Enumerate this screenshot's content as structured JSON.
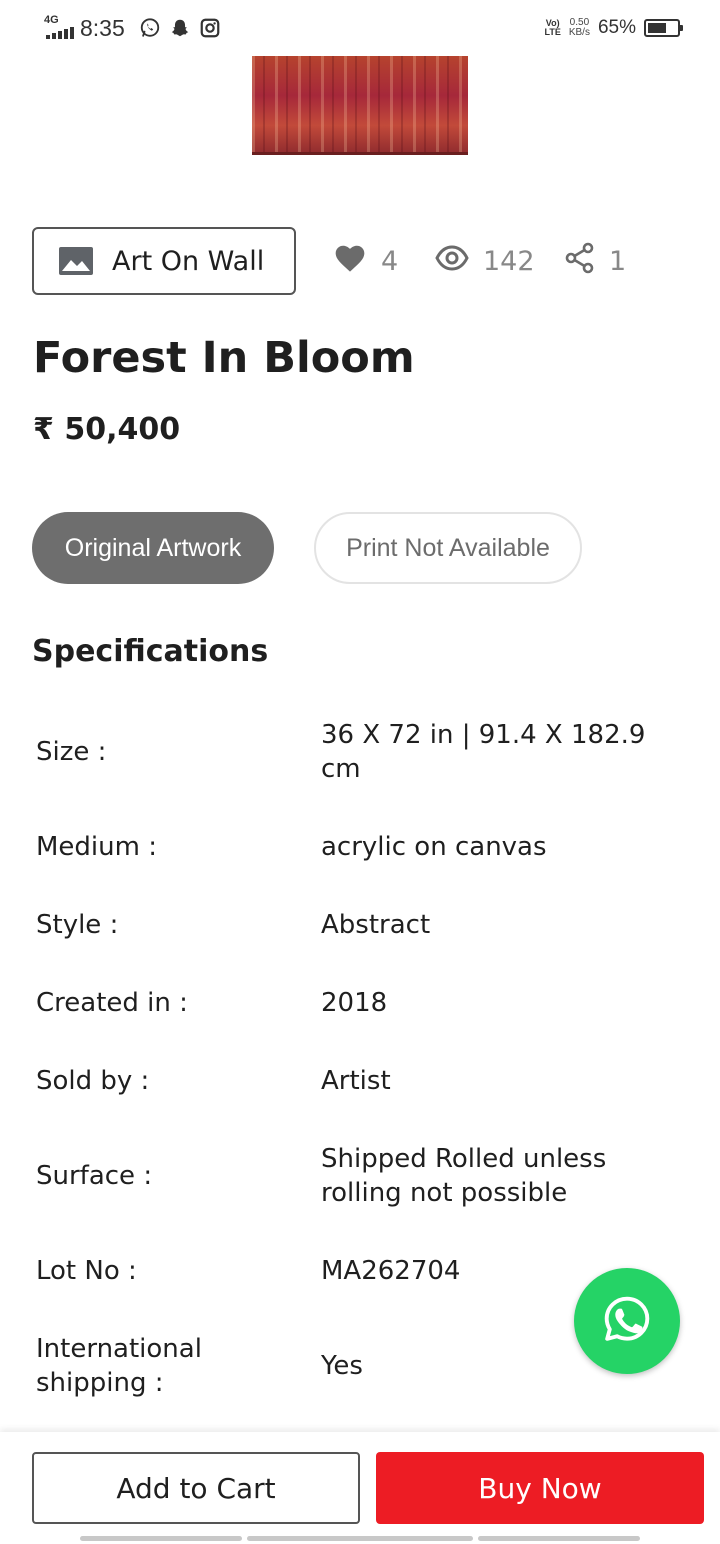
{
  "status_bar": {
    "network": "4G",
    "time": "8:35",
    "apps": [
      "whatsapp-icon",
      "snapchat-icon",
      "instagram-icon"
    ],
    "volte_top": "Vo)",
    "volte_bottom": "LTE",
    "speed_value": "0.50",
    "speed_unit": "KB/s",
    "battery_percent": "65%",
    "battery_level": 0.65
  },
  "artwork": {
    "colors": [
      "#b6432e",
      "#a6283a",
      "#8e2a2e"
    ]
  },
  "info_row": {
    "art_on_wall_label": "Art On Wall",
    "likes": "4",
    "views": "142",
    "shares": "1"
  },
  "product": {
    "title": "Forest In Bloom",
    "price": "₹ 50,400"
  },
  "options": {
    "original": "Original Artwork",
    "print": "Print Not Available"
  },
  "specs": {
    "heading": "Specifications",
    "rows": [
      {
        "label": "Size :",
        "value": "36 X 72 in | 91.4 X 182.9 cm"
      },
      {
        "label": "Medium :",
        "value": "acrylic on canvas"
      },
      {
        "label": "Style :",
        "value": "Abstract"
      },
      {
        "label": "Created in :",
        "value": "2018"
      },
      {
        "label": "Sold by :",
        "value": "Artist"
      },
      {
        "label": "Surface :",
        "value": "Shipped Rolled unless rolling not possible"
      },
      {
        "label": "Lot No :",
        "value": "MA262704"
      },
      {
        "label": "International shipping :",
        "value": "Yes"
      }
    ]
  },
  "actions": {
    "add_to_cart": "Add to Cart",
    "buy_now": "Buy Now"
  },
  "colors": {
    "buy_now": "#ed1c24",
    "whatsapp": "#25d366",
    "pill_selected": "#6e6e6e"
  }
}
